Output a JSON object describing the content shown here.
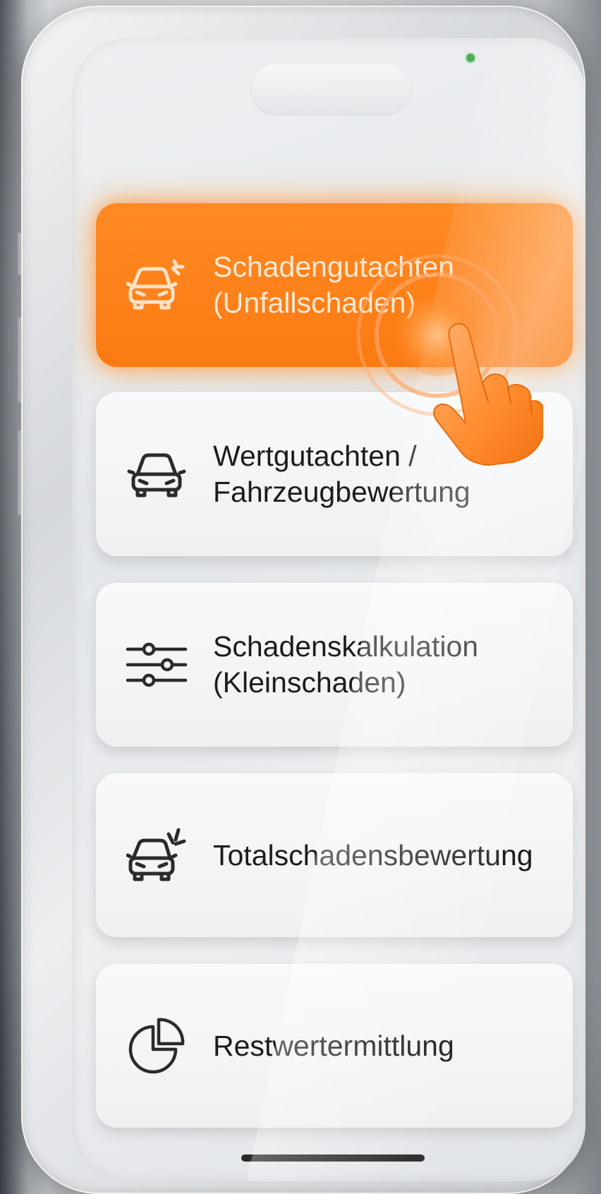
{
  "menu": {
    "items": [
      {
        "label": "Schadengutachten\n(Unfallschaden)",
        "icon": "car-damage-icon",
        "active": true
      },
      {
        "label": "Wertgutachten /\nFahrzeugbewertung",
        "icon": "car-icon",
        "active": false
      },
      {
        "label": "Schadenskalkulation\n(Kleinschaden)",
        "icon": "sliders-icon",
        "active": false
      },
      {
        "label": "Totalschadensbewertung",
        "icon": "car-crash-icon",
        "active": false
      },
      {
        "label": "Restwertermittlung",
        "icon": "pie-chart-icon",
        "active": false
      }
    ]
  },
  "colors": {
    "accent": "#FB7A12",
    "card_background": "#F3F4F6",
    "text_primary": "#1C1C1E",
    "status_dot": "#4CAF50"
  },
  "gesture": {
    "icon": "tap-hand-icon"
  }
}
